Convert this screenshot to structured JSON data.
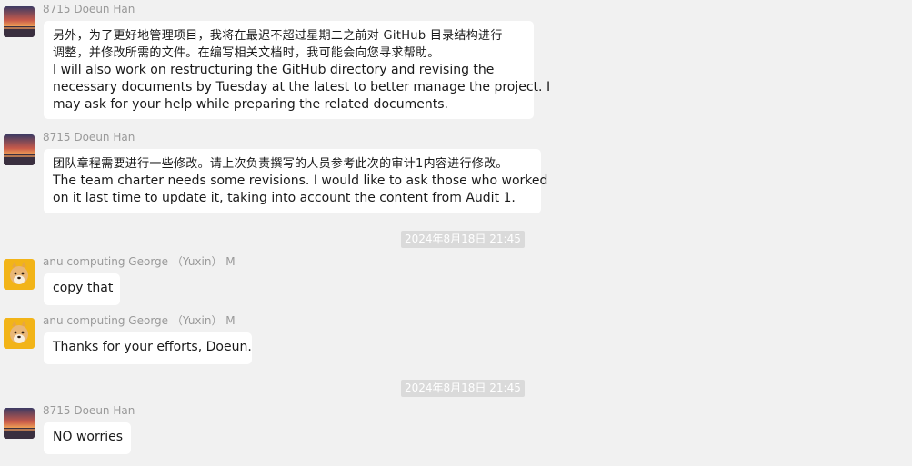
{
  "messages": [
    {
      "sender": "8715 Doeun Han",
      "avatar_icon": "sunset-landscape-avatar",
      "lines": [
        "另外，为了更好地管理项目，我将在最迟不超过星期二之前对 GitHub 目录结构进行",
        "调整，并修改所需的文件。在编写相关文档时，我可能会向您寻求帮助。",
        "I will also work on restructuring the GitHub directory and revising the",
        "necessary documents by Tuesday at the latest to better manage the project. I",
        "may ask for your help while preparing the related documents."
      ]
    },
    {
      "sender": "8715 Doeun Han",
      "avatar_icon": "sunset-landscape-avatar",
      "lines": [
        "团队章程需要进行一些修改。请上次负责撰写的人员参考此次的审计1内容进行修改。",
        "The team charter needs some revisions. I would like to ask those who worked",
        "on it last time to update it, taking into account the content from Audit 1."
      ]
    },
    {
      "sender": "anu computing George （Yuxin） M",
      "avatar_icon": "shiba-dog-avatar",
      "lines": [
        "copy that"
      ]
    },
    {
      "sender": "anu computing George （Yuxin） M",
      "avatar_icon": "shiba-dog-avatar",
      "lines": [
        "Thanks for your efforts, Doeun."
      ]
    },
    {
      "sender": "8715 Doeun Han",
      "avatar_icon": "sunset-landscape-avatar",
      "lines": [
        "NO worries"
      ]
    }
  ],
  "timestamps": [
    "2024年8月18日 21:45",
    "2024年8月18日 21:45"
  ],
  "colors": {
    "background": "#f1f1f1",
    "bubble": "#ffffff",
    "timestamp_bg": "#dadada",
    "sender_text": "#999999"
  }
}
